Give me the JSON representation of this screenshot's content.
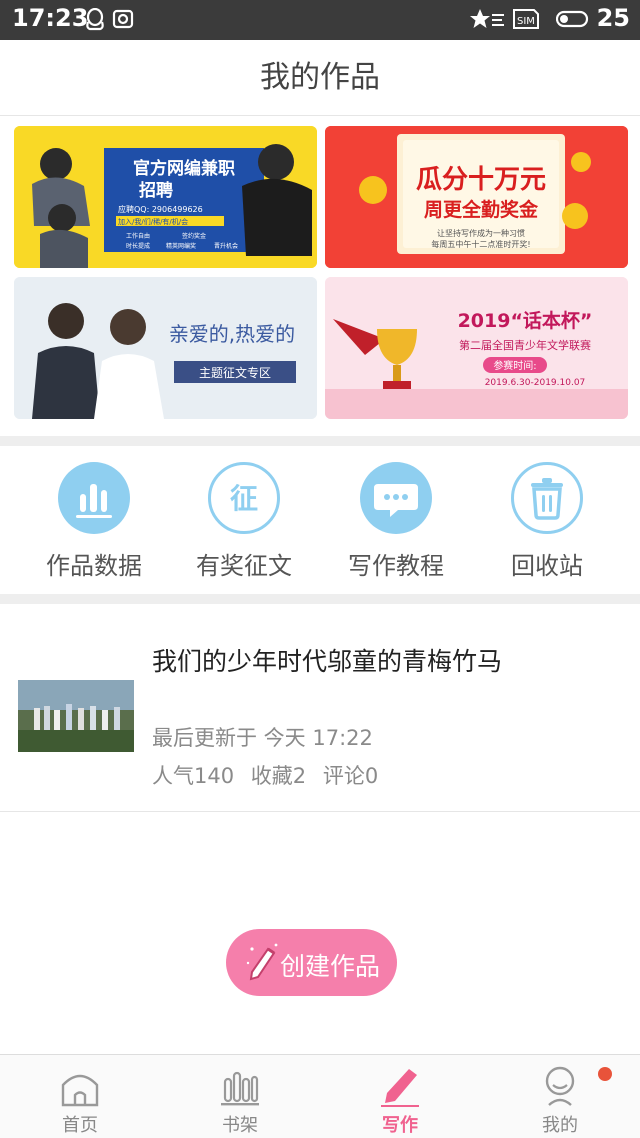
{
  "status_bar": {
    "time": "17:23",
    "battery": "25",
    "sim_label": "SIM",
    "icons": [
      "qq-icon",
      "camera-icon",
      "star-icon",
      "sim-icon",
      "battery-icon"
    ]
  },
  "header": {
    "title": "我的作品"
  },
  "banners": [
    {
      "id": "part-time-editor",
      "line1": "官方网编兼职",
      "line2": "招聘",
      "qq": "应聘QQ: 2906499626",
      "tags": "加入/我/们/稀/有/机/会",
      "perks": [
        "工作自由",
        "签约奖金",
        "时长提成",
        "精英网编奖",
        "晋升机会"
      ],
      "bg": "#f9d926"
    },
    {
      "id": "prize-pool",
      "line1": "瓜分十万元",
      "line2": "周更全勤奖金",
      "sub1": "让坚持写作成为一种习惯",
      "sub2": "每周五中午十二点准时开奖!",
      "bg": "#f24136"
    },
    {
      "id": "theme-essay",
      "line1": "亲爱的,热爱的",
      "line2": "主题征文专区",
      "bg": "#e8eef3"
    },
    {
      "id": "huaben-cup",
      "line1": "2019“话本杯”",
      "line2": "第二届全国青少年文学联赛",
      "badge": "参赛时间:",
      "dates": "2019.6.30-2019.10.07",
      "bg": "#fbe3ea"
    }
  ],
  "quick_menu": [
    {
      "label": "作品数据",
      "icon": "bar-chart-icon"
    },
    {
      "label": "有奖征文",
      "icon": "zheng-icon",
      "glyph": "征"
    },
    {
      "label": "写作教程",
      "icon": "chat-bubble-icon"
    },
    {
      "label": "回收站",
      "icon": "trash-icon"
    }
  ],
  "work": {
    "title": "我们的少年时代邬童的青梅竹马",
    "updated": "最后更新于 今天 17:22",
    "popularity": "人气140",
    "favorites": "收藏2",
    "comments": "评论0"
  },
  "create_button": {
    "label": "创建作品"
  },
  "bottom_nav": [
    {
      "label": "首页",
      "icon": "home-icon"
    },
    {
      "label": "书架",
      "icon": "bookshelf-icon"
    },
    {
      "label": "写作",
      "icon": "pencil-icon",
      "active": true
    },
    {
      "label": "我的",
      "icon": "profile-icon",
      "badge": true
    }
  ],
  "colors": {
    "accent": "#f0628f",
    "create_button": "#f57fab",
    "icon_blue": "#8fcff0",
    "status_bar": "#3b3b3b"
  }
}
